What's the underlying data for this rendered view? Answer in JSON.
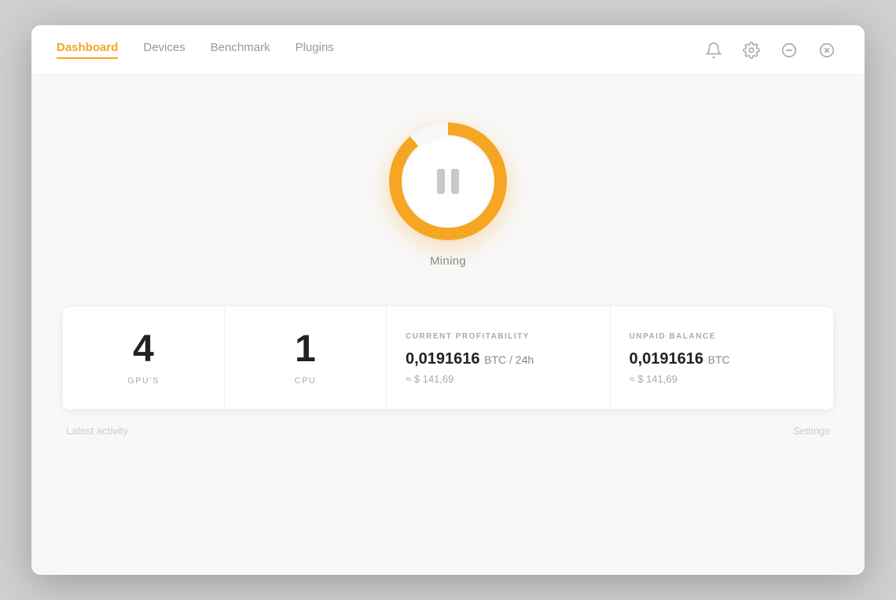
{
  "nav": {
    "items": [
      {
        "id": "dashboard",
        "label": "Dashboard",
        "active": true
      },
      {
        "id": "devices",
        "label": "Devices",
        "active": false
      },
      {
        "id": "benchmark",
        "label": "Benchmark",
        "active": false
      },
      {
        "id": "plugins",
        "label": "Plugins",
        "active": false
      }
    ]
  },
  "header_icons": {
    "bell": "bell-icon",
    "settings": "settings-icon",
    "minimize": "minimize-icon",
    "close": "close-icon"
  },
  "mining": {
    "status_label": "Mining",
    "button_state": "paused"
  },
  "stats": {
    "gpus": {
      "value": "4",
      "label": "GPU'S"
    },
    "cpu": {
      "value": "1",
      "label": "CPU"
    },
    "profitability": {
      "title": "CURRENT PROFITABILITY",
      "btc_value": "0,0191616",
      "btc_unit": "BTC / 24h",
      "usd_approx": "≈ $ 141,69"
    },
    "balance": {
      "title": "UNPAID BALANCE",
      "btc_value": "0,0191616",
      "btc_unit": "BTC",
      "usd_approx": "≈ $ 141,69"
    }
  },
  "bottom": {
    "left_hint": "Latest activity",
    "right_hint": "Settings"
  }
}
